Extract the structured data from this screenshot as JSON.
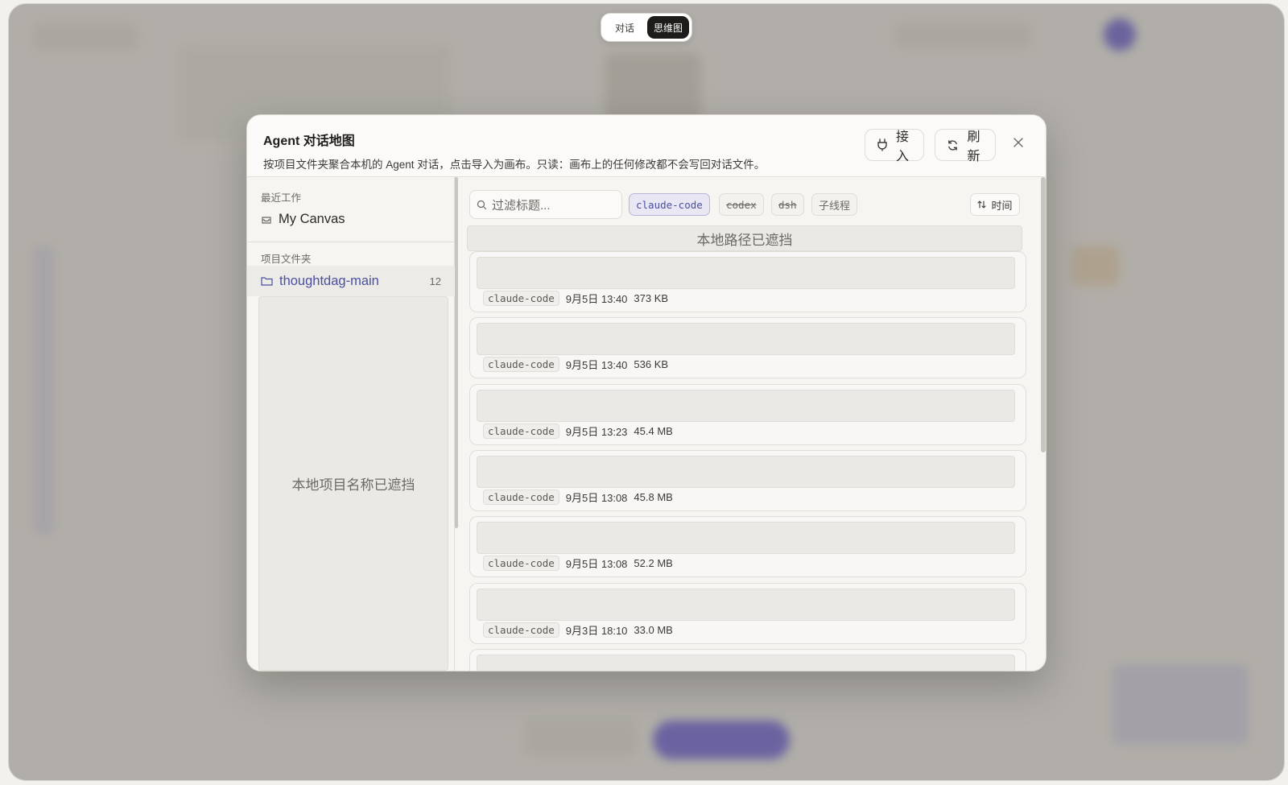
{
  "mode_toggle": {
    "chat_label": "对话",
    "mindmap_label": "思维图",
    "active": "思维图"
  },
  "modal": {
    "title": "Agent 对话地图",
    "subtitle": "按项目文件夹聚合本机的 Agent 对话，点击导入为画布。只读：画布上的任何修改都不会写回对话文件。",
    "connect_label": "接入",
    "refresh_label": "刷新",
    "close_icon": "close-icon"
  },
  "sidebar": {
    "recent_label": "最近工作",
    "recent_items": [
      {
        "label": "My Canvas",
        "icon": "canvas-icon"
      }
    ],
    "folders_label": "项目文件夹",
    "folders": [
      {
        "label": "thoughtdag-main",
        "count": "12",
        "icon": "folder-icon"
      }
    ],
    "mask_text": "本地项目名称已遮挡"
  },
  "filters": {
    "search_placeholder": "过滤标题...",
    "chips": [
      {
        "label": "claude-code",
        "state": "active"
      },
      {
        "label": "codex",
        "state": "disabled"
      },
      {
        "label": "dsh",
        "state": "disabled"
      },
      {
        "label": "子线程",
        "state": "normal"
      }
    ],
    "sort_label": "时间"
  },
  "path_mask_text": "本地路径已遮挡",
  "sessions": [
    {
      "source": "claude-code",
      "time": "9月5日 13:40",
      "size": "373 KB"
    },
    {
      "source": "claude-code",
      "time": "9月5日 13:40",
      "size": "536 KB"
    },
    {
      "source": "claude-code",
      "time": "9月5日 13:23",
      "size": "45.4 MB"
    },
    {
      "source": "claude-code",
      "time": "9月5日 13:08",
      "size": "45.8 MB"
    },
    {
      "source": "claude-code",
      "time": "9月5日 13:08",
      "size": "52.2 MB"
    },
    {
      "source": "claude-code",
      "time": "9月3日 18:10",
      "size": "33.0 MB"
    }
  ],
  "colors": {
    "accent": "#4a4fa0",
    "active_toggle": "#1d1c1a",
    "overlay": "#78746e"
  }
}
